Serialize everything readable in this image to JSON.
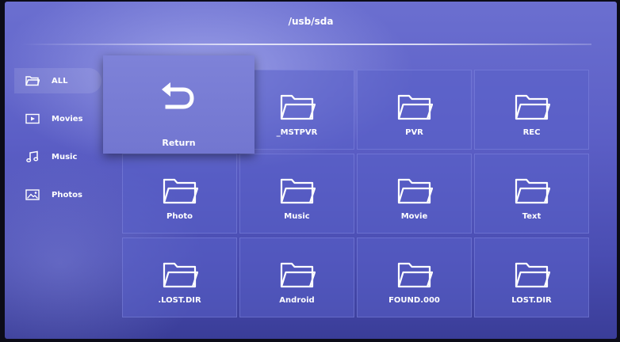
{
  "header": {
    "path": "/usb/sda"
  },
  "sidebar": {
    "items": [
      {
        "label": "ALL",
        "icon": "folder-icon",
        "active": true
      },
      {
        "label": "Movies",
        "icon": "movie-icon",
        "active": false
      },
      {
        "label": "Music",
        "icon": "music-note-icon",
        "active": false
      },
      {
        "label": "Photos",
        "icon": "photo-icon",
        "active": false
      }
    ]
  },
  "grid": {
    "return_label": "Return",
    "folders": [
      {
        "label": "_MSTPVR"
      },
      {
        "label": "PVR"
      },
      {
        "label": "REC"
      },
      {
        "label": "Photo"
      },
      {
        "label": "Music"
      },
      {
        "label": "Movie"
      },
      {
        "label": "Text"
      },
      {
        "label": ".LOST.DIR"
      },
      {
        "label": "Android"
      },
      {
        "label": "FOUND.000"
      },
      {
        "label": "LOST.DIR"
      }
    ]
  },
  "colors": {
    "background": "#5c5fc6",
    "tile": "#5a60c8",
    "focused_tile": "#7e82d8",
    "text": "#ffffff"
  }
}
